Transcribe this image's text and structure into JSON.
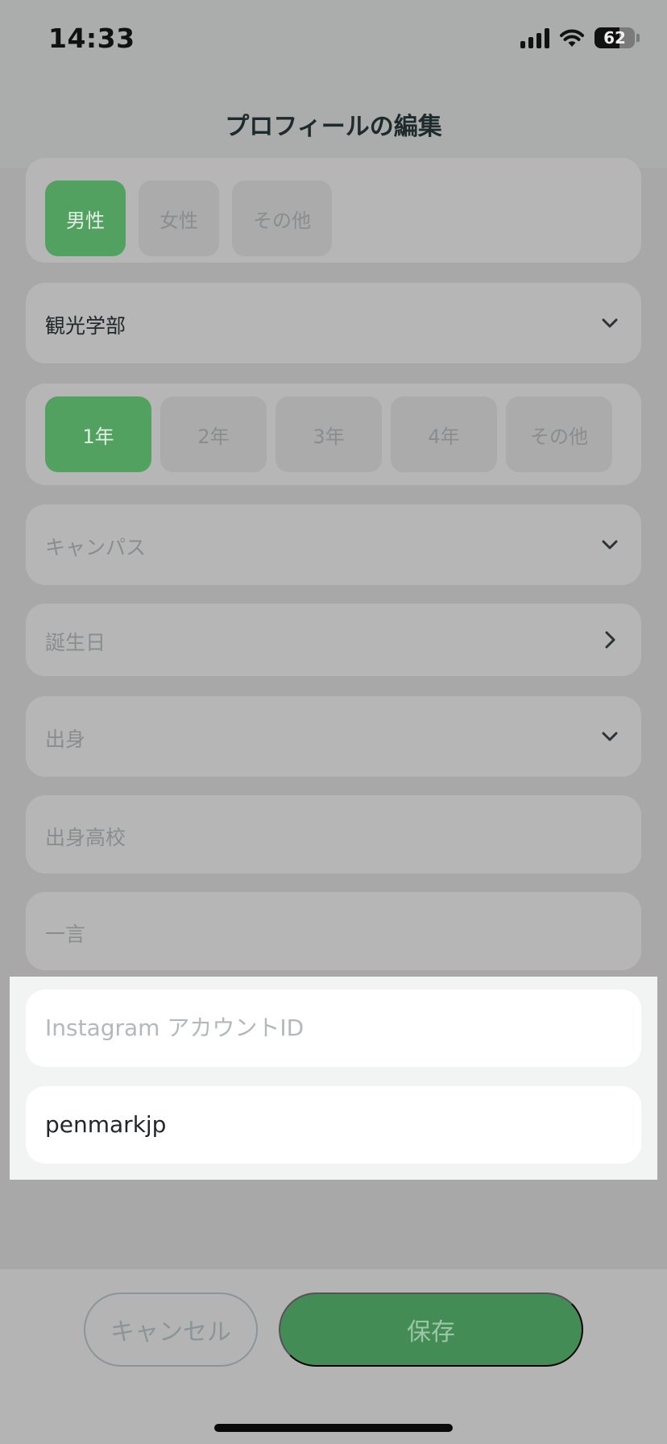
{
  "status_bar": {
    "time": "14:33",
    "battery_level": "62",
    "battery_fraction": 0.62,
    "icons": [
      "cellular-signal-icon",
      "wifi-icon",
      "battery-icon"
    ]
  },
  "header": {
    "title": "プロフィールの編集"
  },
  "gender": {
    "options": [
      "男性",
      "女性",
      "その他"
    ],
    "selected": "男性"
  },
  "faculty": {
    "value": "観光学部",
    "icon": "chevron-down-icon"
  },
  "grade": {
    "options": [
      "1年",
      "2年",
      "3年",
      "4年",
      "その他"
    ],
    "selected": "1年"
  },
  "campus": {
    "placeholder": "キャンパス",
    "icon": "chevron-down-icon"
  },
  "birthday": {
    "placeholder": "誕生日",
    "icon": "chevron-right-icon"
  },
  "hometown": {
    "placeholder": "出身",
    "icon": "chevron-down-icon"
  },
  "high_school": {
    "placeholder": "出身高校"
  },
  "comment": {
    "placeholder": "一言"
  },
  "instagram": {
    "placeholder": "Instagram アカウントID",
    "value": "penmarkjp"
  },
  "actions": {
    "cancel_label": "キャンセル",
    "save_label": "保存"
  },
  "colors": {
    "accent": "#52a160",
    "save_button": "#438c55",
    "text_primary": "#1f2729",
    "placeholder": "#b3b8bc"
  }
}
